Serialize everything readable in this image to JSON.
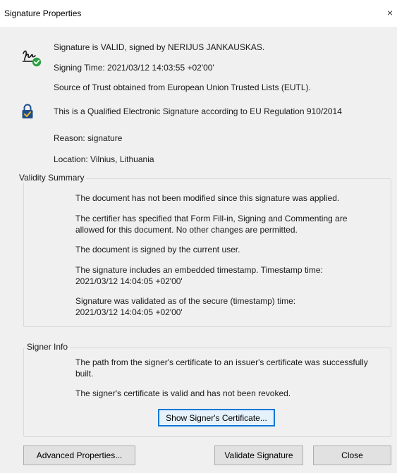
{
  "window": {
    "title": "Signature Properties",
    "close_glyph": "×"
  },
  "summary": {
    "status": "Signature is VALID, signed by NERIJUS JANKAUSKAS.",
    "signing_time": "Signing Time:  2021/03/12 14:03:55 +02'00'",
    "trust_source": "Source of Trust obtained from European Union Trusted Lists (EUTL).",
    "qualified": "This is a Qualified Electronic Signature according to EU Regulation 910/2014",
    "reason": "Reason:  signature",
    "location": "Location:  Vilnius, Lithuania",
    "signature_icon": "signature-valid-icon",
    "qualified_icon": "qualified-signature-lock-icon"
  },
  "validity": {
    "label": "Validity Summary",
    "items": [
      "The document has not been modified since this signature was applied.",
      "The certifier has specified that Form Fill-in, Signing and Commenting are allowed for this document. No other changes are permitted.",
      "The document is signed by the current user.",
      "The signature includes an embedded timestamp. Timestamp time: 2021/03/12 14:04:05 +02'00'",
      "Signature was validated as of the secure (timestamp) time: 2021/03/12 14:04:05 +02'00'"
    ]
  },
  "signer": {
    "label": "Signer Info",
    "items": [
      "The path from the signer's certificate to an issuer's certificate was successfully built.",
      "The signer's certificate is valid and has not been revoked."
    ],
    "show_cert_label": "Show Signer's Certificate..."
  },
  "footer": {
    "advanced_label": "Advanced Properties...",
    "validate_label": "Validate Signature",
    "close_label": "Close"
  },
  "colors": {
    "window_bg": "#f0f0f0",
    "check_green": "#2ea043",
    "lock_blue": "#1f4e8c",
    "focus_blue": "#0078d7"
  }
}
